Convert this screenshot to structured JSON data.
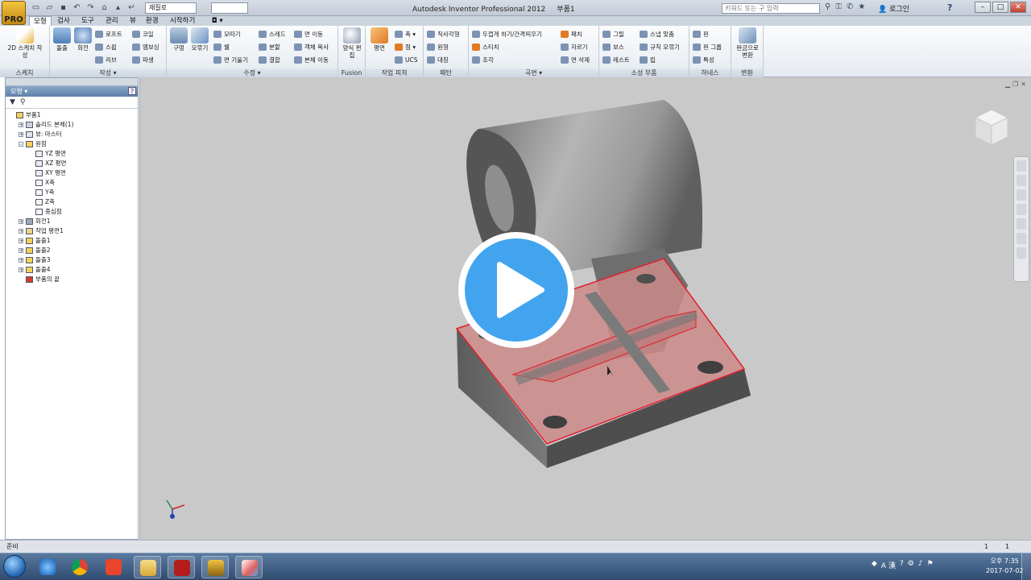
{
  "app": {
    "button_label": "PRO",
    "title": "Autodesk Inventor Professional 2012",
    "document": "부품1",
    "material": "재질로",
    "search_placeholder": "키워드 또는 구 입력",
    "login": "로그인",
    "help": "?"
  },
  "qat_icons": [
    "new-icon",
    "open-icon",
    "save-icon",
    "undo-icon",
    "redo-icon",
    "home-icon",
    "select-icon",
    "return-icon"
  ],
  "tabs": [
    {
      "label": "모형",
      "active": true
    },
    {
      "label": "검사"
    },
    {
      "label": "도구"
    },
    {
      "label": "관리"
    },
    {
      "label": "뷰"
    },
    {
      "label": "환경"
    },
    {
      "label": "시작하기"
    },
    {
      "label": "◘ ▾"
    }
  ],
  "ribbon": {
    "sketch": {
      "title": "스케치",
      "create_sketch": "2D 스케치 작성"
    },
    "create": {
      "title": "작성 ▾",
      "extrude": "돌출",
      "revolve": "회전",
      "loft": "로프트",
      "sweep": "스윕",
      "rib": "리브",
      "coil": "코일",
      "emboss": "엠보싱",
      "derive": "파생"
    },
    "modify": {
      "title": "수정 ▾",
      "hole": "구멍",
      "fillet": "모깎기",
      "chamfer": "모따기",
      "shell": "쉘",
      "draft": "면 기울기",
      "thread": "스레드",
      "split": "분할",
      "combine": "결합",
      "move_face": "면 이동",
      "copy_object": "객체 복사",
      "move_bodies": "본체 이동"
    },
    "fusion": {
      "title": "Fusion",
      "edit_form": "양식 편집"
    },
    "work_features": {
      "title": "작업 피쳐",
      "plane": "평면",
      "axis": "축 ▾",
      "point": "점 ▾",
      "ucs": "UCS"
    },
    "pattern": {
      "title": "패턴",
      "rectangular": "직사각형",
      "circular": "원형",
      "mirror": "대칭"
    },
    "surface": {
      "title": "곡면 ▾",
      "thicken": "두껍게 하기/간격띄우기",
      "stitch": "스티치",
      "sculpt": "조각",
      "patch": "패치",
      "trim": "자르기",
      "delete_face": "면 삭제"
    },
    "plastic": {
      "title": "소성 부품",
      "grill": "그릴",
      "boss": "보스",
      "rest": "레스트",
      "snap_fit": "스냅 맞춤",
      "rule_fillet": "규칙 모깎기",
      "lip": "립"
    },
    "harness": {
      "title": "하네스",
      "pin": "핀",
      "pin_group": "핀 그룹",
      "property": "특성"
    },
    "convert": {
      "title": "변환",
      "to_sheet_metal": "판금으로 변환"
    }
  },
  "browser": {
    "title": "모형 ▾",
    "help": "?",
    "nodes": [
      {
        "label": "부품1",
        "level": 0,
        "expand": "",
        "icon_color": "#f2d15a"
      },
      {
        "label": "솔리드 본체(1)",
        "level": 1,
        "expand": "+",
        "icon_color": "#c9d3df"
      },
      {
        "label": "뷰: 마스터",
        "level": 1,
        "expand": "+",
        "icon_color": "#dfe4ea"
      },
      {
        "label": "원점",
        "level": 1,
        "expand": "-",
        "icon_color": "#f2d15a"
      },
      {
        "label": "YZ 평면",
        "level": 2,
        "expand": "",
        "icon_color": "#e8edf2"
      },
      {
        "label": "XZ 평면",
        "level": 2,
        "expand": "",
        "icon_color": "#e8edf2"
      },
      {
        "label": "XY 평면",
        "level": 2,
        "expand": "",
        "icon_color": "#e8edf2"
      },
      {
        "label": "X축",
        "level": 2,
        "expand": "",
        "icon_color": "#f3f3f3"
      },
      {
        "label": "Y축",
        "level": 2,
        "expand": "",
        "icon_color": "#f3f3f3"
      },
      {
        "label": "Z축",
        "level": 2,
        "expand": "",
        "icon_color": "#f3f3f3"
      },
      {
        "label": "중심점",
        "level": 2,
        "expand": "",
        "icon_color": "#f3f3f3"
      },
      {
        "label": "회전1",
        "level": 1,
        "expand": "+",
        "icon_color": "#9aa8b8"
      },
      {
        "label": "작업 평면1",
        "level": 1,
        "expand": "+",
        "icon_color": "#e8d38a"
      },
      {
        "label": "돌출1",
        "level": 1,
        "expand": "+",
        "icon_color": "#f2d15a"
      },
      {
        "label": "돌출2",
        "level": 1,
        "expand": "+",
        "icon_color": "#f2d15a"
      },
      {
        "label": "돌출3",
        "level": 1,
        "expand": "+",
        "icon_color": "#f2d15a"
      },
      {
        "label": "돌출4",
        "level": 1,
        "expand": "+",
        "icon_color": "#f2d15a"
      },
      {
        "label": "부품의 끝",
        "level": 1,
        "expand": "",
        "icon_color": "#d23a2a"
      }
    ]
  },
  "status": {
    "text": "준비",
    "count1": "1",
    "count2": "1"
  },
  "taskbar": {
    "apps": [
      "start-button",
      "ie-icon",
      "chrome-icon",
      "media-player-icon",
      "explorer-icon",
      "acrobat-icon",
      "inventor-icon",
      "paint-icon"
    ],
    "tray_lang": "A 漢",
    "time": "오후 7:35",
    "date": "2017-07-02"
  },
  "colors": {
    "selection": "#e0202a",
    "viewport_bg": "#c9c9c9",
    "play_button": "#42a4ee"
  }
}
